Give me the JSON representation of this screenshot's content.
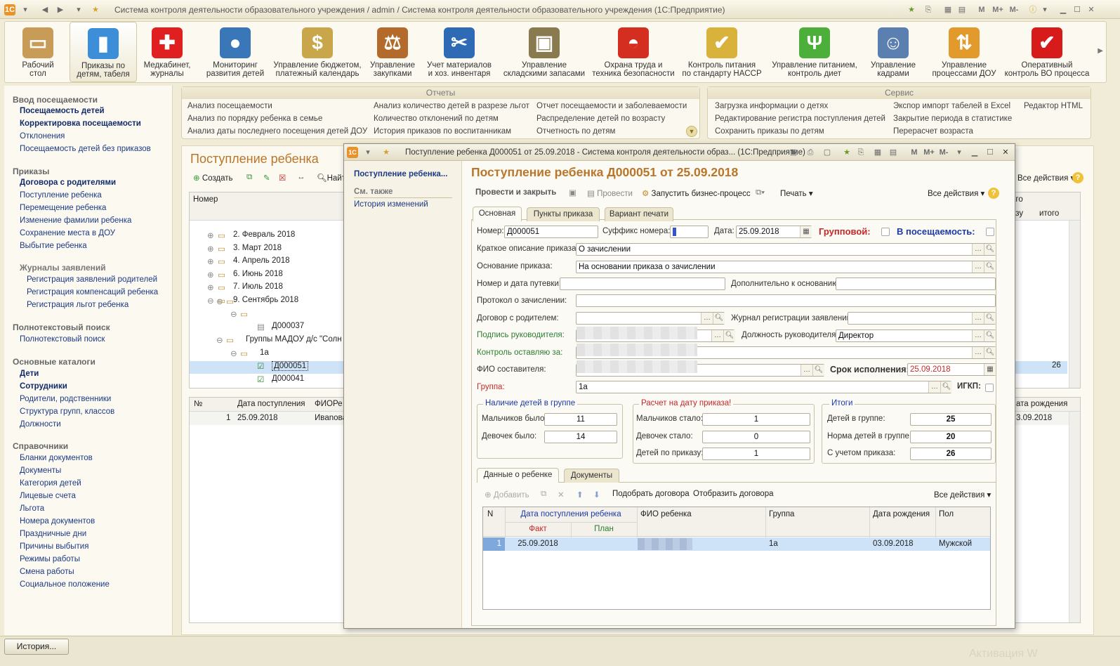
{
  "app": {
    "title": "Система контроля деятельности образовательного учреждения / admin / Система контроля деятельности образовательного учреждения  (1С:Предприятие)",
    "title_mem": [
      "M",
      "M+",
      "M-"
    ]
  },
  "ribbon": [
    {
      "l1": "Рабочий",
      "l2": "стол",
      "icon": "desk-icon",
      "color": "#c89b56"
    },
    {
      "l1": "Приказы по",
      "l2": "детям, табеля",
      "icon": "chart-icon",
      "color": "#3c8ed8"
    },
    {
      "l1": "Медкабинет,",
      "l2": "журналы",
      "icon": "red-cross-icon",
      "color": "#e02020"
    },
    {
      "l1": "Мониторинг",
      "l2": "развития детей",
      "icon": "globe-icon",
      "color": "#3a77b8"
    },
    {
      "l1": "Управление бюджетом,",
      "l2": "платежный календарь",
      "icon": "money-bag-icon",
      "color": "#c9a64a"
    },
    {
      "l1": "Управление",
      "l2": "закупками",
      "icon": "scales-icon",
      "color": "#b46a2a"
    },
    {
      "l1": "Учет материалов",
      "l2": "и хоз. инвентаря",
      "icon": "tools-icon",
      "color": "#2f6bb5"
    },
    {
      "l1": "Управление",
      "l2": "складскими запасами",
      "icon": "forklift-icon",
      "color": "#8a7a50"
    },
    {
      "l1": "Охрана труда и",
      "l2": "техника безопасности",
      "icon": "helmet-icon",
      "color": "#d42e20"
    },
    {
      "l1": "Контроль питания",
      "l2": "по стандарту HACCP",
      "icon": "haccp-icon",
      "color": "#d8b23a"
    },
    {
      "l1": "Управление питанием,",
      "l2": "контроль диет",
      "icon": "cutlery-icon",
      "color": "#4caf3a"
    },
    {
      "l1": "Управление",
      "l2": "кадрами",
      "icon": "person-icon",
      "color": "#5b7fb0"
    },
    {
      "l1": "Управление",
      "l2": "процессами ДОУ",
      "icon": "flow-icon",
      "color": "#e39a2c"
    },
    {
      "l1": "Оперативный",
      "l2": "контроль ВО процесса",
      "icon": "checkmark-icon",
      "color": "#d71a1a"
    }
  ],
  "nav": {
    "sec1": "Ввод посещаемости",
    "sec1_items": [
      "Посещаемость детей",
      "Корректировка посещаемости",
      "Отклонения",
      "Посещаемость детей без приказов"
    ],
    "sec2": "Приказы",
    "sec2_items": [
      "Договора с родителями",
      "Поступление ребенка",
      "Перемещение ребенка",
      "Изменение фамилии ребенка",
      "Сохранение места в ДОУ",
      "Выбытие ребенка"
    ],
    "sec2_sub": "Журналы заявлений",
    "sec2_sub_items": [
      "Регистрация заявлений родителей",
      "Регистрация компенсаций ребенка",
      "Регистрация льгот ребенка"
    ],
    "sec3": "Полнотекстовый поиск",
    "sec3_items": [
      "Полнотекстовый поиск"
    ],
    "sec4": "Основные каталоги",
    "sec4_items": [
      "Дети",
      "Сотрудники",
      "Родители, родственники",
      "Структура групп, классов",
      "Должности"
    ],
    "sec5": "Справочники",
    "sec5_items": [
      "Бланки документов",
      "Документы",
      "Категория детей",
      "Лицевые счета",
      "Льгота",
      "Номера документов",
      "Праздничные дни",
      "Причины выбытия",
      "Режимы работы",
      "Смена работы",
      "Социальное положение"
    ]
  },
  "reports": {
    "title": "Отчеты",
    "col1": [
      "Анализ посещаемости",
      "Анализ по порядку ребенка в семье",
      "Анализ даты последнего посещения детей ДОУ"
    ],
    "col2": [
      "Анализ количество детей в разрезе льгот",
      "Количество отклонений по детям",
      "История приказов по воспитанникам"
    ],
    "col3": [
      "Отчет посещаемости и заболеваемости",
      "Распределение детей по возрасту",
      "Отчетность по детям"
    ]
  },
  "service": {
    "title": "Сервис",
    "col1": [
      "Загрузка информации о детях",
      "Редактирование регистра поступления детей",
      "Сохранить приказы по детям"
    ],
    "col2": [
      "Экспор импорт табелей в Excel",
      "Закрытие периода в статистике",
      "Перерасчет возраста"
    ],
    "col3": [
      "Редактор HTML"
    ]
  },
  "bglist": {
    "title": "Поступление ребенка",
    "create": "Создать",
    "find": "Найт",
    "all_actions": "Все действия",
    "col_number": "Номер",
    "col_ego": "его",
    "col_zu": "азу",
    "col_itogo": "итого",
    "tree": [
      {
        "t": "2. Февраль 2018",
        "d": 1
      },
      {
        "t": "3. Март 2018",
        "d": 1
      },
      {
        "t": "4. Апрель 2018",
        "d": 1
      },
      {
        "t": "6. Июнь 2018",
        "d": 1
      },
      {
        "t": "7. Июль 2018",
        "d": 1
      },
      {
        "t": "9. Сентябрь 2018",
        "d": 1
      }
    ],
    "doc1": "Д000037",
    "groups": "Группы МАДОУ д/с \"Солн",
    "group_1a": "1а",
    "doc_sel": "Д000051",
    "doc2": "Д000041",
    "right_val": "26",
    "lower_cols": [
      "№",
      "Дата поступления",
      "ФИОРе"
    ],
    "lower_right_col": "ата рождения",
    "lower_row": {
      "n": "1",
      "date": "25.09.2018",
      "fio": "Ивanова",
      "birth": "3.09.2018"
    }
  },
  "doc": {
    "window_title": "Поступление ребенка Д000051 от 25.09.2018 - Система контроля деятельности образ...  (1С:Предприятие)",
    "left_main": "Поступление ребенка...",
    "left_see_also": "См. также",
    "left_history": "История изменений",
    "heading": "Поступление ребенка Д000051 от 25.09.2018",
    "btn_post_close": "Провести и закрыть",
    "btn_post": "Провести",
    "btn_bp": "Запустить бизнес-процесс",
    "btn_print": "Печать",
    "btn_all": "Все действия",
    "tabs": [
      "Основная",
      "Пункты приказа",
      "Вариант печати"
    ],
    "f": {
      "number_lbl": "Номер:",
      "number": "Д000051",
      "suffix_lbl": "Суффикс номера:",
      "suffix": "",
      "date_lbl": "Дата:",
      "date": "25.09.2018",
      "group_flag_lbl": "Групповой:",
      "attend_flag_lbl": "В посещаемость:",
      "short_lbl": "Краткое описание приказа:",
      "short": "О зачислении",
      "basis_lbl": "Основание приказа:",
      "basis": "На основании приказа о зачислении",
      "voucher_lbl": "Номер и дата путевки:",
      "voucher": "",
      "extra_lbl": "Дополнительно к основанию:",
      "extra": "",
      "protocol_lbl": "Протокол о зачислении:",
      "protocol": "",
      "contract_lbl": "Договор с родителем:",
      "contract": "",
      "journal_lbl": "Журнал регистрации заявлений:",
      "journal": "",
      "sign_lbl": "Подпись руководителя:",
      "position_lbl": "Должность руководителя:",
      "position": "Директор",
      "control_lbl": "Контроль оставляю за:",
      "author_lbl": "ФИО составителя:",
      "deadline_lbl": "Срок исполнения:",
      "deadline": "25.09.2018",
      "group_lbl": "Группа:",
      "group": "1а",
      "igkp_lbl": "ИГКП:"
    },
    "g1": {
      "title": "Наличие детей в группе",
      "boys_lbl": "Мальчиков было:",
      "boys": "11",
      "girls_lbl": "Девочек было:",
      "girls": "14"
    },
    "g2": {
      "title": "Расчет на дату приказа!",
      "boys_lbl": "Мальчиков стало:",
      "boys": "1",
      "girls_lbl": "Девочек стало:",
      "girls": "0",
      "kids_lbl": "Детей по приказу:",
      "kids": "1"
    },
    "g3": {
      "title": "Итоги",
      "ingroup_lbl": "Детей в группе:",
      "ingroup": "25",
      "norm_lbl": "Норма детей в группе:",
      "norm": "20",
      "after_lbl": "С учетом приказа:",
      "after": "26"
    },
    "tabs2": [
      "Данные о ребенке",
      "Документы"
    ],
    "t2_add": "Добавить",
    "t2_pick": "Подобрать договора",
    "t2_show": "Отобразить договора",
    "t2_all": "Все действия",
    "table": {
      "h_n": "N",
      "h_date": "Дата поступления ребенка",
      "h_fact": "Факт",
      "h_plan": "План",
      "h_fio": "ФИО ребенка",
      "h_group": "Группа",
      "h_birth": "Дата рождения",
      "h_sex": "Пол",
      "row": {
        "n": "1",
        "fact": "25.09.2018",
        "plan": "",
        "group": "1а",
        "birth": "03.09.2018",
        "sex": "Мужской"
      }
    }
  },
  "bottom": {
    "history": "История...",
    "watermark": "Активация W"
  },
  "colors": {
    "accent": "#b9762a",
    "selected_row": "#cfe3f8",
    "link": "#1c3a85",
    "red": "#c62828"
  }
}
